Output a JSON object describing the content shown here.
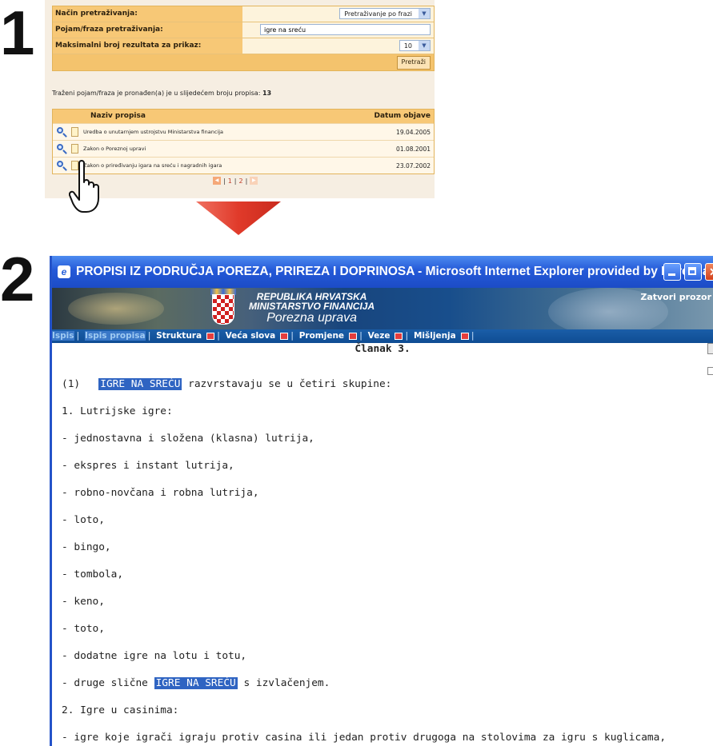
{
  "steps": {
    "one": "1",
    "two": "2"
  },
  "panel1": {
    "form": {
      "mode_label": "Način pretraživanja:",
      "mode_value": "Pretraživanje po frazi",
      "term_label": "Pojam/fraza pretraživanja:",
      "term_value": "igre na sreću",
      "max_label": "Maksimalni broj rezultata za prikaz:",
      "max_value": "10",
      "submit_label": "Pretraži"
    },
    "result_text": "Traženi pojam/fraza je pronađen(a) je u slijedećem broju propisa:",
    "result_count": "13",
    "table": {
      "col_name": "Naziv propisa",
      "col_date": "Datum objave",
      "rows": [
        {
          "name": "Uredba o unutarnjem ustrojstvu Ministarstva financija",
          "date": "19.04.2005"
        },
        {
          "name": "Zakon o Poreznoj upravi",
          "date": "01.08.2001"
        },
        {
          "name": "Zakon o priređivanju igara na sreću i nagradnih igara",
          "date": "23.07.2002"
        }
      ]
    },
    "pager": {
      "page1": "1",
      "page2": "2",
      "sep": "|"
    }
  },
  "ie": {
    "title": "PROPISI IZ PODRUČJA POREZA, PRIREZA I DOPRINOSA - Microsoft Internet Explorer provided by Porezna ...",
    "banner": {
      "line1": "REPUBLIKA HRVATSKA",
      "line2": "MINISTARSTVO FINANCIJA",
      "line3": "Porezna uprava",
      "close_link": "Zatvori prozor"
    },
    "menu": {
      "ispis": "Ispis",
      "ispis_propisa": "Ispis propisa",
      "struktura": "Struktura",
      "veca_slova": "Veća slova",
      "promjene": "Promjene",
      "veze": "Veze",
      "misljenja": "Mišljenja"
    },
    "article": {
      "heading": "Članak 3.",
      "p1_prefix": "(1)",
      "p1_highlight": "IGRE NA SREĆU",
      "p1_rest": "razvrstavaju se u četiri skupine:",
      "l1": "1. Lutrijske igre:",
      "l2": "- jednostavna i složena (klasna) lutrija,",
      "l3": "- ekspres i instant lutrija,",
      "l4": "- robno-novčana i robna lutrija,",
      "l5": "- loto,",
      "l6": "- bingo,",
      "l7": "- tombola,",
      "l8": "- keno,",
      "l9": "- toto,",
      "l10": "- dodatne igre na lotu i totu,",
      "l11_prefix": "- druge slične",
      "l11_highlight": "IGRE NA SREĆU",
      "l11_rest": "s izvlačenjem.",
      "l12": "2. Igre u casinima:",
      "l13": "- igre koje igrači igraju protiv casina ili jedan protiv drugoga na stolovima za igru s kuglicama,"
    }
  }
}
